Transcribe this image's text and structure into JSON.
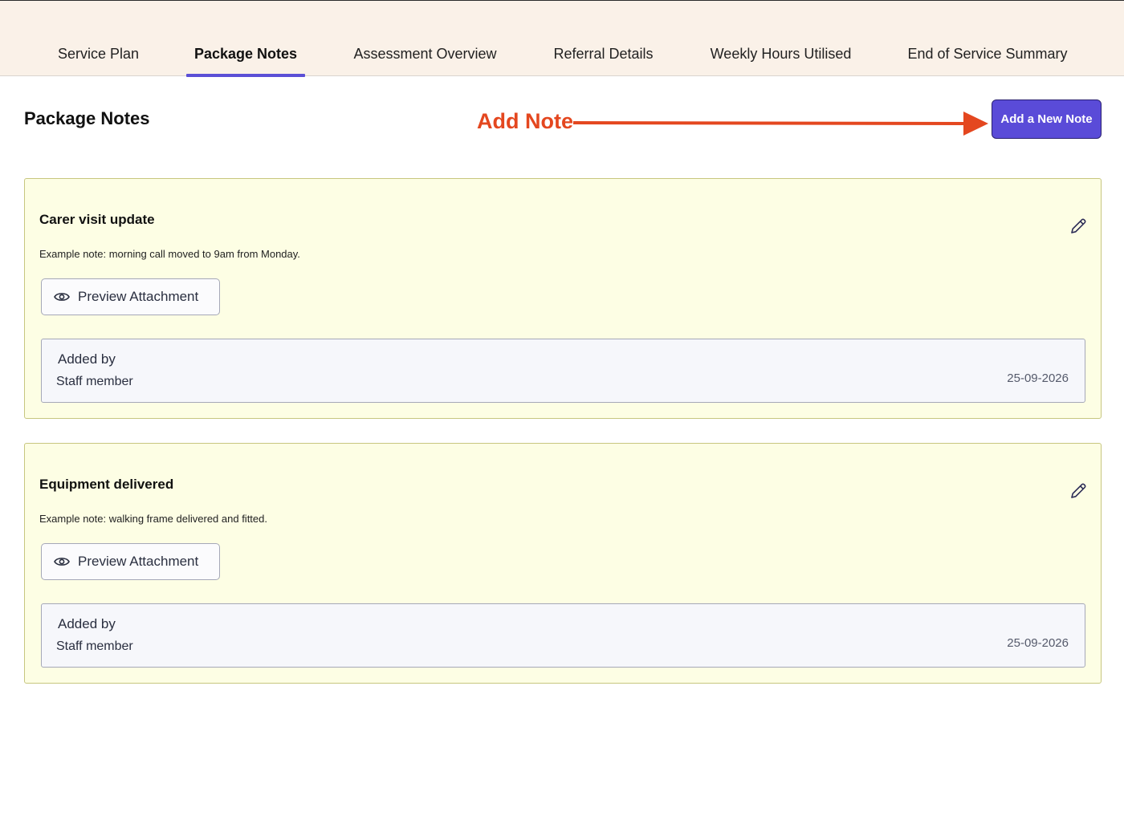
{
  "tabs": [
    {
      "label": "Service Plan",
      "active": false
    },
    {
      "label": "Package Notes",
      "active": true
    },
    {
      "label": "Assessment Overview",
      "active": false
    },
    {
      "label": "Referral Details",
      "active": false
    },
    {
      "label": "Weekly Hours Utilised",
      "active": false
    },
    {
      "label": "End of Service Summary",
      "active": false
    }
  ],
  "page": {
    "title": "Package Notes",
    "annotation_label": "Add Note",
    "add_button_label": "Add a New Note"
  },
  "notes": [
    {
      "title": "Carer visit update",
      "body": "Example note: morning call moved to 9am from Monday.",
      "preview_label": "Preview Attachment",
      "added_by_label": "Added by",
      "author": "Staff member",
      "date": "25-09-2026"
    },
    {
      "title": "Equipment delivered",
      "body": "Example note: walking frame delivered and fitted.",
      "preview_label": "Preview Attachment",
      "added_by_label": "Added by",
      "author": "Staff member",
      "date": "25-09-2026"
    }
  ],
  "colors": {
    "accent": "#5a4bd8",
    "annotation": "#e4471f",
    "note_background": "#fdfee4",
    "topbar": "#faf1e8"
  },
  "icons": {
    "edit": "pencil-icon",
    "preview": "eye-icon",
    "annotation": "arrow-right-icon"
  }
}
